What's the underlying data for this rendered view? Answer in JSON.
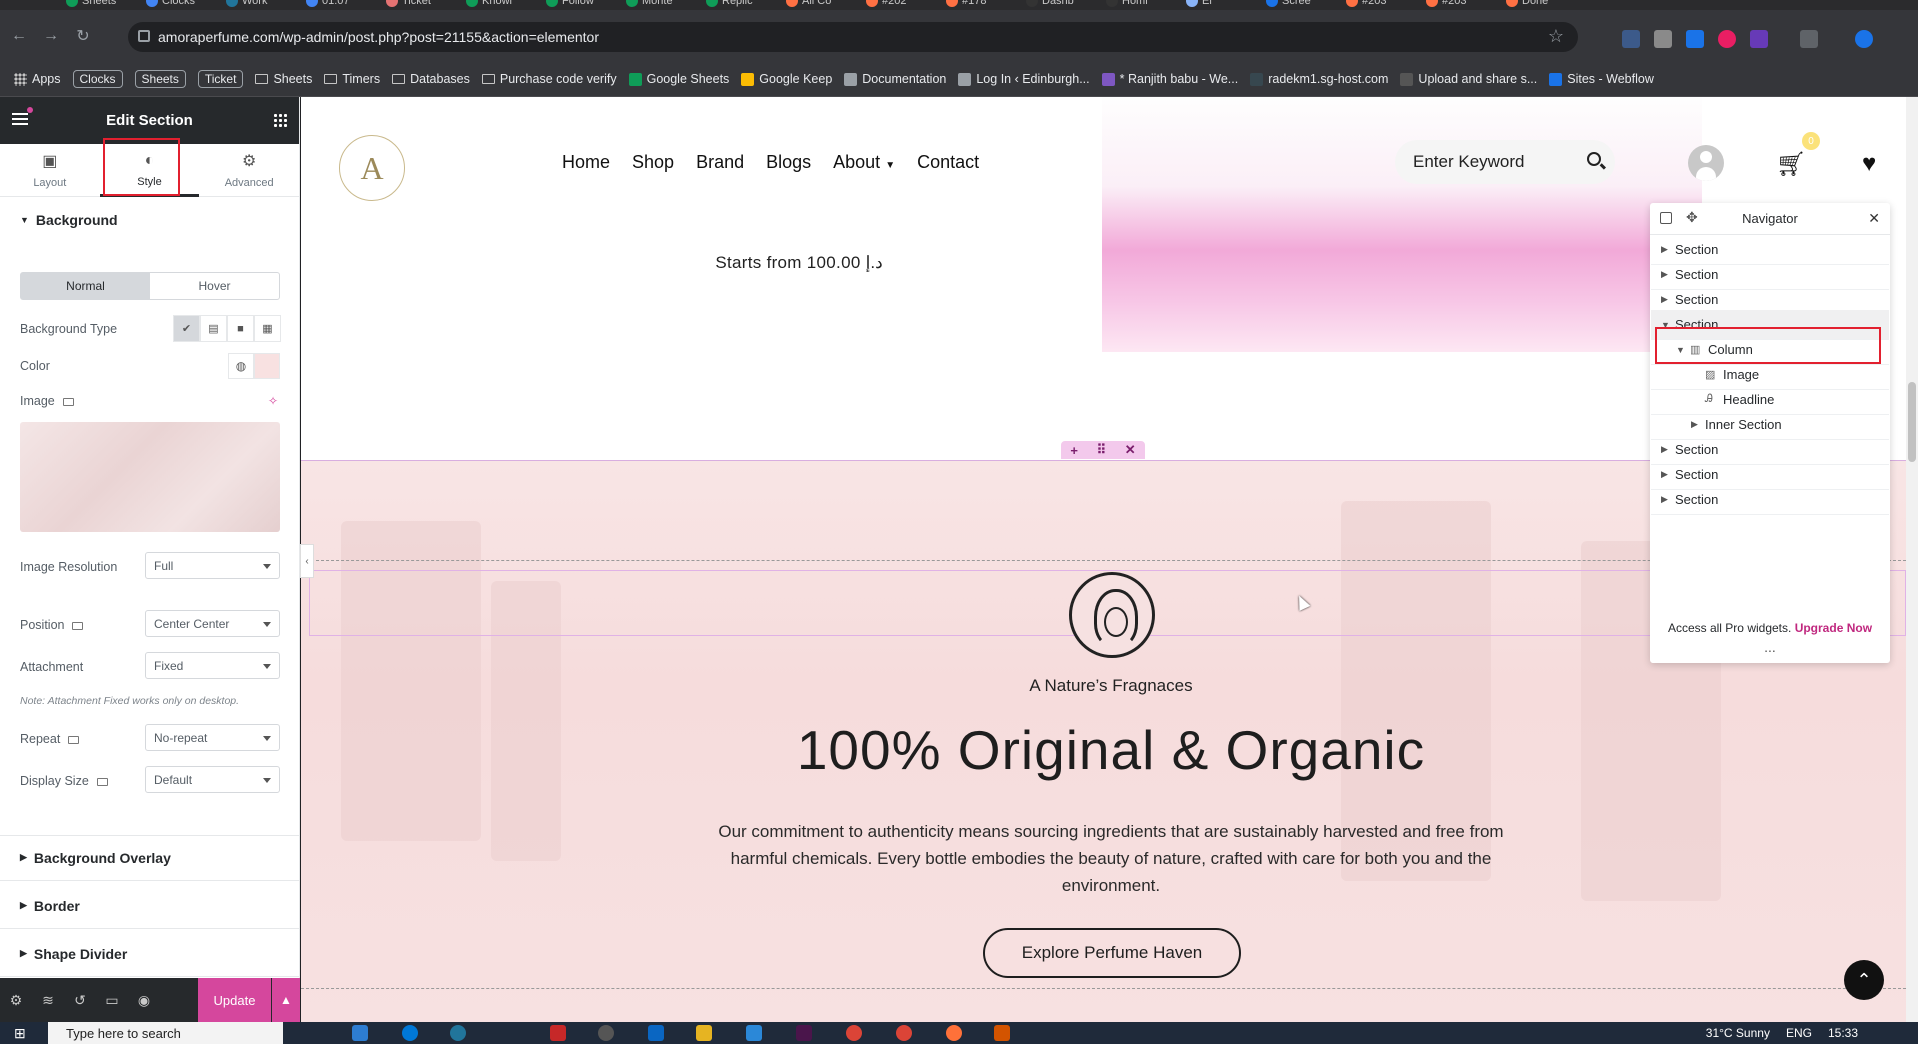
{
  "browser": {
    "url": "amoraperfume.com/wp-admin/post.php?post=21155&action=elementor",
    "tabs": [
      "Sheets",
      "Clocks",
      "Work",
      "01:07",
      "Ticket",
      "Knowl",
      "Follow",
      "Monte",
      "Replic",
      "All Co",
      "#202",
      "#178",
      "Dashb",
      "Homi",
      "El",
      "Scree",
      "#203",
      "#203",
      "Done"
    ]
  },
  "bookmarks": [
    {
      "label": "Apps"
    },
    {
      "label": "Clocks"
    },
    {
      "label": "Sheets"
    },
    {
      "label": "Ticket"
    },
    {
      "label": "Sheets"
    },
    {
      "label": "Timers"
    },
    {
      "label": "Databases"
    },
    {
      "label": "Purchase code verify"
    },
    {
      "label": "Google Sheets"
    },
    {
      "label": "Google Keep"
    },
    {
      "label": "Documentation"
    },
    {
      "label": "Log In ‹ Edinburgh..."
    },
    {
      "label": "* Ranjith babu - We..."
    },
    {
      "label": "radekm1.sg-host.com"
    },
    {
      "label": "Upload and share s..."
    },
    {
      "label": "Sites - Webflow"
    }
  ],
  "editor": {
    "title": "Edit Section",
    "tabs": {
      "layout": "Layout",
      "style": "Style",
      "advanced": "Advanced"
    },
    "background": {
      "heading": "Background",
      "normal": "Normal",
      "hover": "Hover",
      "type_label": "Background Type",
      "color_label": "Color",
      "image_label": "Image",
      "resolution_label": "Image Resolution",
      "resolution_value": "Full",
      "position_label": "Position",
      "position_value": "Center Center",
      "attachment_label": "Attachment",
      "attachment_value": "Fixed",
      "note": "Note: Attachment Fixed works only on desktop.",
      "repeat_label": "Repeat",
      "repeat_value": "No-repeat",
      "size_label": "Display Size",
      "size_value": "Default"
    },
    "sections": [
      "Background Overlay",
      "Border",
      "Shape Divider"
    ],
    "update": "Update"
  },
  "site": {
    "logo": "A",
    "nav": [
      "Home",
      "Shop",
      "Brand",
      "Blogs",
      "About",
      "Contact"
    ],
    "search_placeholder": "Enter Keyword",
    "cart_count": "0",
    "price": "Starts from 100.00 د.إ",
    "hero": {
      "tagline": "A Nature’s Fragnaces",
      "headline": "100% Original & Organic",
      "paragraph": "Our commitment to authenticity means sourcing ingredients that are sustainably harvested and free from harmful chemicals. Every bottle embodies the beauty of nature, crafted with care for both you and the environment.",
      "cta": "Explore Perfume Haven"
    }
  },
  "navigator": {
    "title": "Navigator",
    "items": [
      {
        "label": "Section",
        "level": 0,
        "open": false
      },
      {
        "label": "Section",
        "level": 0,
        "open": false
      },
      {
        "label": "Section",
        "level": 0,
        "open": false
      },
      {
        "label": "Section",
        "level": 0,
        "open": true
      },
      {
        "label": "Column",
        "level": 1,
        "open": true
      },
      {
        "label": "Image",
        "level": 2
      },
      {
        "label": "Headline",
        "level": 2
      },
      {
        "label": "Inner Section",
        "level": 2,
        "open": false
      },
      {
        "label": "Section",
        "level": 0,
        "open": false
      },
      {
        "label": "Section",
        "level": 0,
        "open": false
      },
      {
        "label": "Section",
        "level": 0,
        "open": false
      }
    ],
    "footer": "Access all Pro widgets.",
    "upgrade": "Upgrade Now"
  },
  "taskbar": {
    "search": "Type here to search",
    "weather": "31°C Sunny",
    "lang": "ENG",
    "time": "15:33"
  }
}
